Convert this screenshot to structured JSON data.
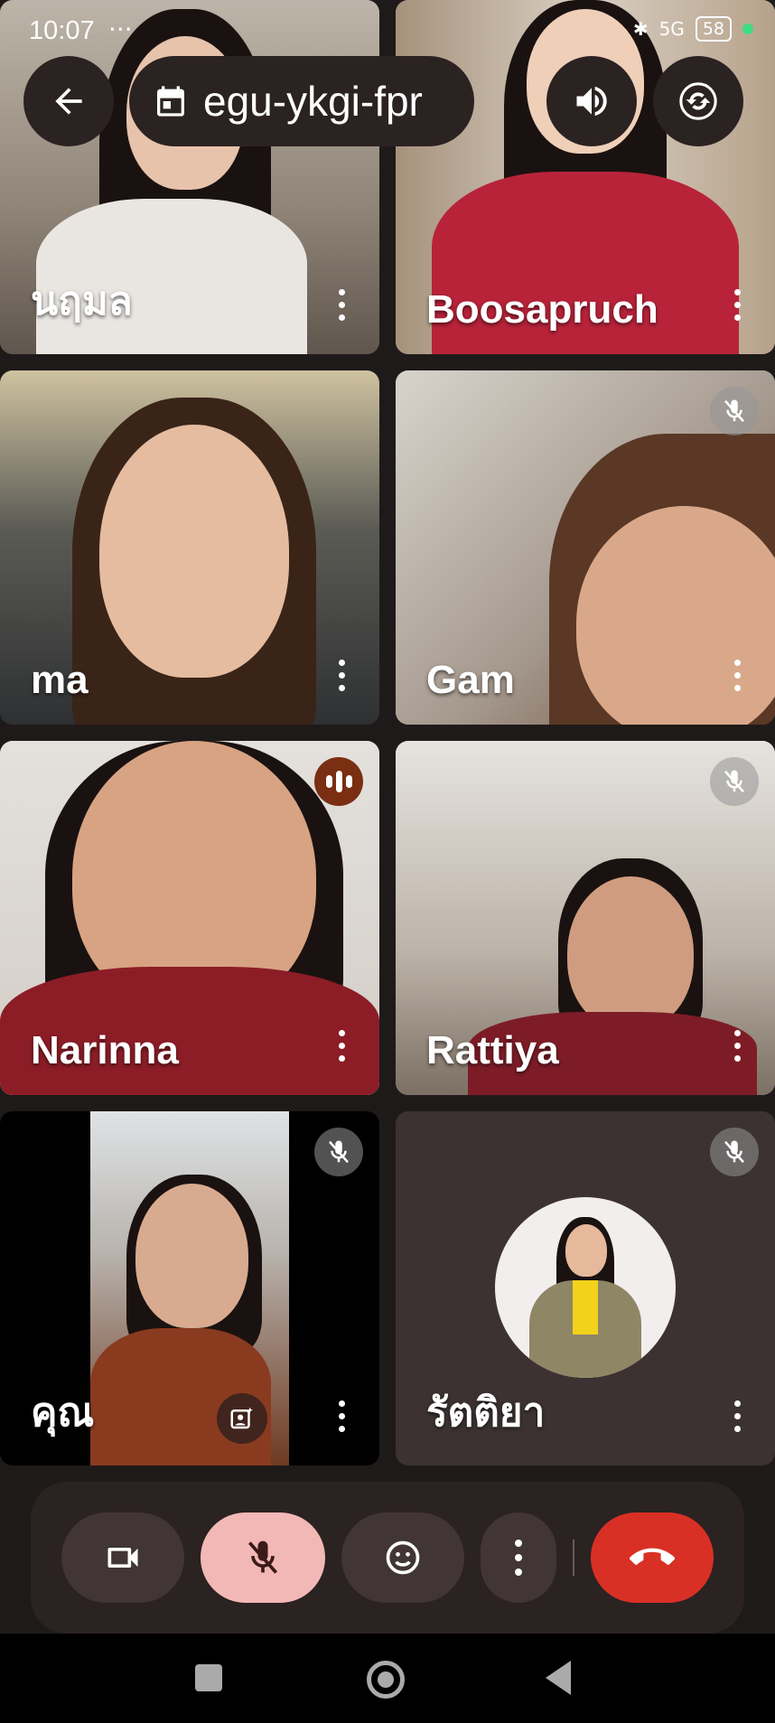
{
  "status": {
    "time": "10:07",
    "dots": "···",
    "network": "5G",
    "battery": "58"
  },
  "meeting": {
    "code": "egu-ykgi-fpr"
  },
  "tiles": [
    {
      "name": "นฤมล",
      "state": "speaking"
    },
    {
      "name": "Boosapruch",
      "state": "normal"
    },
    {
      "name": "ma",
      "state": "normal"
    },
    {
      "name": "Gam",
      "state": "muted"
    },
    {
      "name": "Narinna",
      "state": "speaking-audio"
    },
    {
      "name": "Rattiya",
      "state": "muted"
    },
    {
      "name": "คุณ",
      "state": "muted-self"
    },
    {
      "name": "รัตติยา",
      "state": "muted-avatar"
    }
  ],
  "controls": {
    "camera": "camera-icon",
    "mic": "mic-off-icon",
    "emoji": "emoji-icon",
    "more": "more-vert-icon",
    "end_call": "end-call-icon"
  },
  "colors": {
    "background": "#1f1a1a",
    "mic_off_bg": "#f2b8b5",
    "end_call": "#d93025",
    "speaking_border": "#7b3820"
  }
}
